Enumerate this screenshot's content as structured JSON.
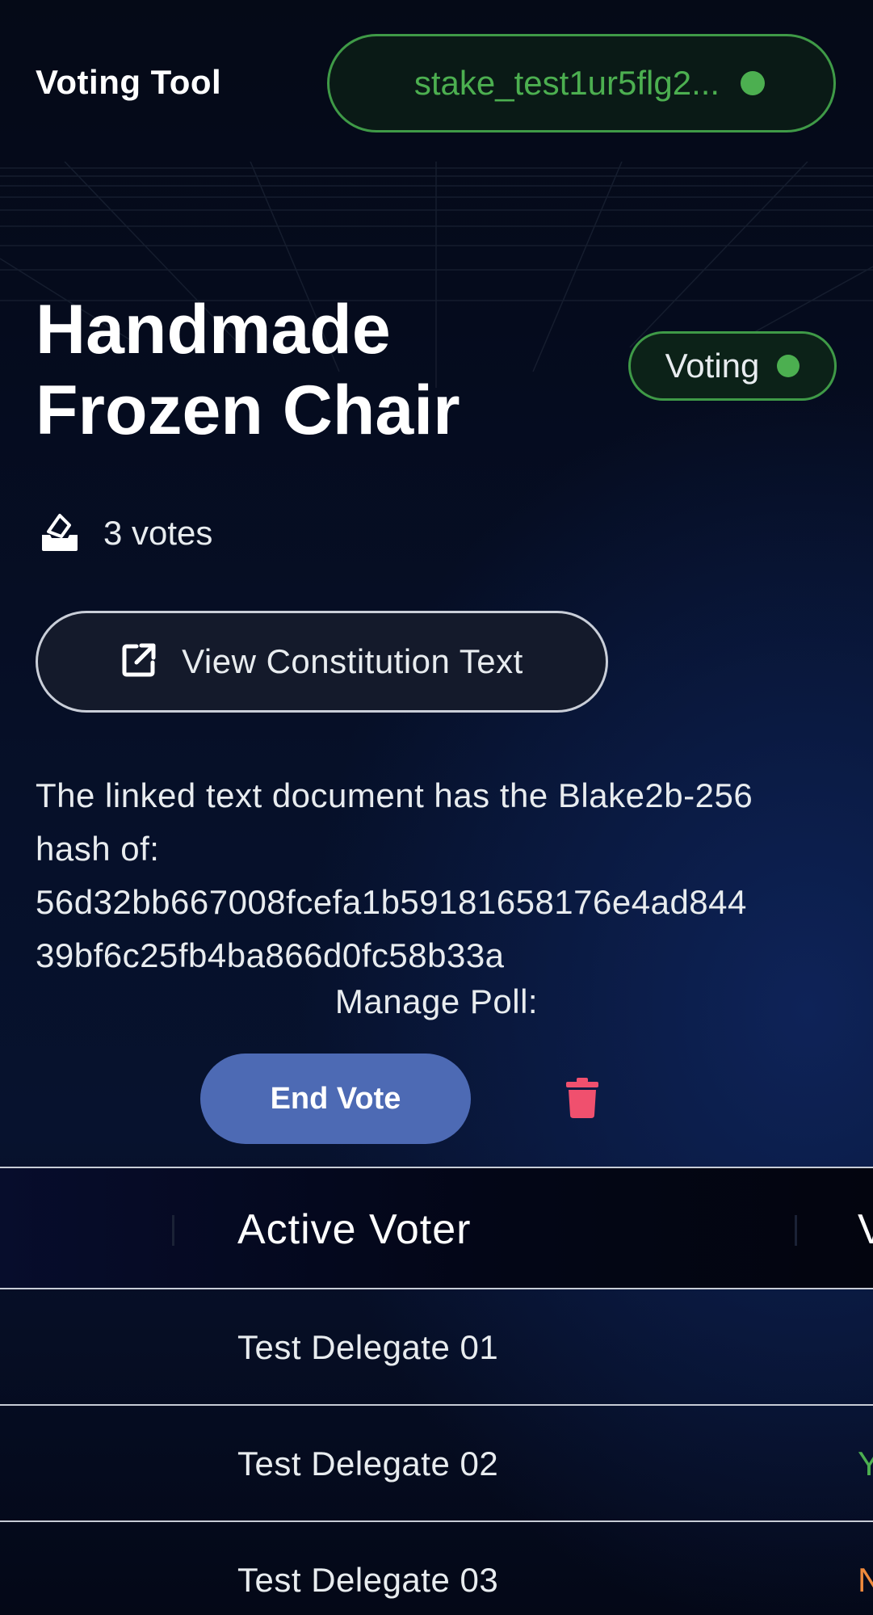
{
  "header": {
    "app_title": "Voting Tool",
    "wallet_address": "stake_test1ur5flg2...",
    "wallet_status_color": "#4caf50"
  },
  "poll": {
    "title_line1": "Handmade",
    "title_line2": "Frozen Chair",
    "status_label": "Voting",
    "status_color": "#4caf50",
    "votes_text": "3 votes",
    "constitution_button_label": "View Constitution Text",
    "hash_intro_line1": "The linked text document has the Blake2b-256",
    "hash_intro_line2": "hash of:",
    "hash_line1": "56d32bb667008fcefa1b59181658176e4ad844",
    "hash_line2": "39bf6c25fb4ba866d0fc58b33a",
    "manage_label": "Manage Poll:",
    "end_vote_label": "End Vote",
    "delete_color": "#f0506e"
  },
  "table": {
    "headers": [
      "Active Voter",
      "V"
    ],
    "rows": [
      {
        "voter": "Test Delegate 01",
        "vote": "",
        "vote_color": "#4caf50"
      },
      {
        "voter": "Test Delegate 02",
        "vote": "Y",
        "vote_color": "#4caf50"
      },
      {
        "voter": "Test Delegate 03",
        "vote": "N",
        "vote_color": "#f08a3c"
      }
    ]
  },
  "icons": {
    "vote_icon": "ballot-box-icon",
    "external_link_icon": "external-link-icon",
    "delete_icon": "trash-icon"
  }
}
